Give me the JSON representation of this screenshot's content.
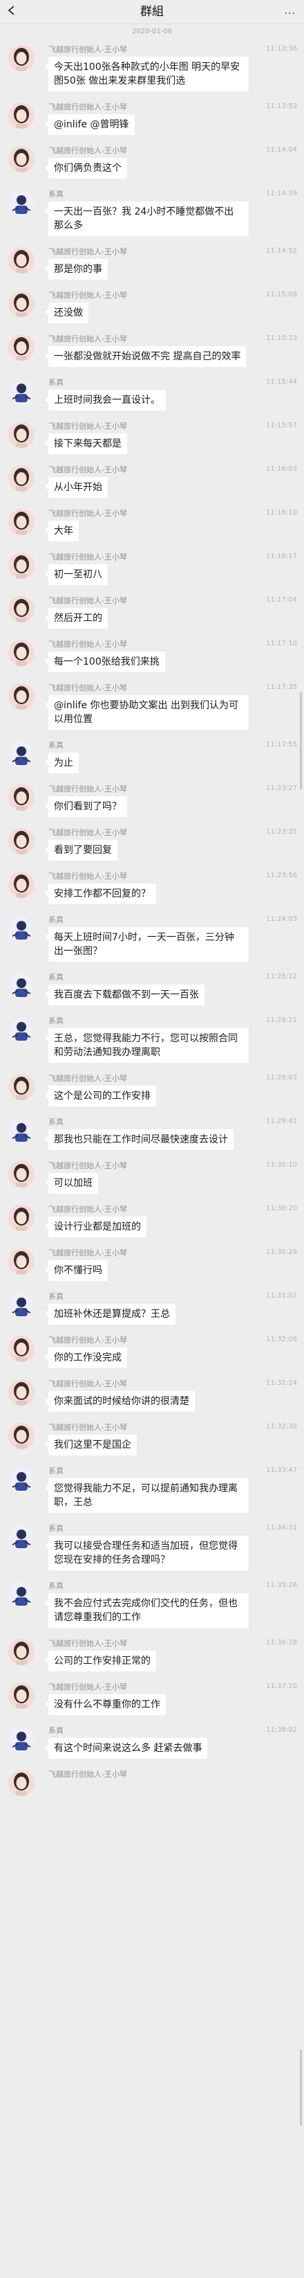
{
  "header": {
    "title": "群組",
    "more": "···"
  },
  "date_separator": "2020-01-06",
  "messages": [
    {
      "sender": "wang",
      "name": "飞越旅行创始人-王小琴",
      "time": "11:13:36",
      "text": "今天出100张各种款式的小年图 明天的早安图50张 做出来发来群里我们选"
    },
    {
      "sender": "wang",
      "name": "飞越旅行创始人-王小琴",
      "time": "11:13:53",
      "text": "@inlife @曾明锋"
    },
    {
      "sender": "wang",
      "name": "飞越旅行创始人-王小琴",
      "time": "11:14:04",
      "text": "你们俩负责这个"
    },
    {
      "sender": "xi",
      "name": "系真",
      "time": "11:14:39",
      "text": "一天出一百张？我 24小时不睡觉都做不出那么多"
    },
    {
      "sender": "wang",
      "name": "飞越旅行创始人-王小琴",
      "time": "11:14:52",
      "text": "那是你的事"
    },
    {
      "sender": "wang",
      "name": "飞越旅行创始人-王小琴",
      "time": "11:15:09",
      "text": "还没做"
    },
    {
      "sender": "wang",
      "name": "飞越旅行创始人-王小琴",
      "time": "11:15:33",
      "text": "一张都没做就开始说做不完 提高自己的效率"
    },
    {
      "sender": "xi",
      "name": "系真",
      "time": "11:15:44",
      "text": "上班时间我会一直设计。"
    },
    {
      "sender": "wang",
      "name": "飞越旅行创始人-王小琴",
      "time": "11:15:57",
      "text": "接下来每天都是"
    },
    {
      "sender": "wang",
      "name": "飞越旅行创始人-王小琴",
      "time": "11:16:03",
      "text": "从小年开始"
    },
    {
      "sender": "wang",
      "name": "飞越旅行创始人-王小琴",
      "time": "11:16:10",
      "text": "大年"
    },
    {
      "sender": "wang",
      "name": "飞越旅行创始人-王小琴",
      "time": "11:16:17",
      "text": "初一至初八"
    },
    {
      "sender": "wang",
      "name": "飞越旅行创始人-王小琴",
      "time": "11:17:04",
      "text": "然后开工的"
    },
    {
      "sender": "wang",
      "name": "飞越旅行创始人-王小琴",
      "time": "11:17:10",
      "text": "每一个100张给我们来挑"
    },
    {
      "sender": "wang",
      "name": "飞越旅行创始人-王小琴",
      "time": "11:17:35",
      "text": "@inlife 你也要协助文案出 出到我们认为可以用位置"
    },
    {
      "sender": "xi",
      "name": "系真",
      "time": "11:17:55",
      "text": "为止"
    },
    {
      "sender": "wang",
      "name": "飞越旅行创始人-王小琴",
      "time": "11:23:27",
      "text": "你们看到了吗？"
    },
    {
      "sender": "wang",
      "name": "飞越旅行创始人-王小琴",
      "time": "11:23:35",
      "text": "看到了要回复"
    },
    {
      "sender": "wang",
      "name": "飞越旅行创始人-王小琴",
      "time": "11:23:56",
      "text": "安排工作都不回复的？"
    },
    {
      "sender": "xi",
      "name": "系真",
      "time": "11:24:03",
      "text": "每天上班时间7小时，一天一百张，三分钟出一张图？"
    },
    {
      "sender": "xi",
      "name": "系真",
      "time": "11:25:12",
      "text": "我百度去下载都做不到一天一百张"
    },
    {
      "sender": "xi",
      "name": "系真",
      "time": "11:28:21",
      "text": "王总，您觉得我能力不行，您可以按照合同和劳动法通知我办理离职"
    },
    {
      "sender": "wang",
      "name": "飞越旅行创始人-王小琴",
      "time": "11:29:03",
      "text": "这个是公司的工作安排"
    },
    {
      "sender": "xi",
      "name": "系真",
      "time": "11:29:41",
      "text": "那我也只能在工作时间尽最快速度去设计"
    },
    {
      "sender": "wang",
      "name": "飞越旅行创始人-王小琴",
      "time": "11:30:10",
      "text": "可以加班"
    },
    {
      "sender": "wang",
      "name": "飞越旅行创始人-王小琴",
      "time": "11:30:20",
      "text": "设计行业都是加班的"
    },
    {
      "sender": "wang",
      "name": "飞越旅行创始人-王小琴",
      "time": "11:30:29",
      "text": "你不懂行吗"
    },
    {
      "sender": "xi",
      "name": "系真",
      "time": "11:31:02",
      "text": "加班补休还是算提成？王总"
    },
    {
      "sender": "wang",
      "name": "飞越旅行创始人-王小琴",
      "time": "11:32:08",
      "text": "你的工作没完成"
    },
    {
      "sender": "wang",
      "name": "飞越旅行创始人-王小琴",
      "time": "11:32:24",
      "text": "你来面试的时候给你讲的很清楚"
    },
    {
      "sender": "wang",
      "name": "飞越旅行创始人-王小琴",
      "time": "11:32:36",
      "text": "我们这里不是国企"
    },
    {
      "sender": "xi",
      "name": "系真",
      "time": "11:33:47",
      "text": "您觉得我能力不足，可以提前通知我办理离职，王总"
    },
    {
      "sender": "xi",
      "name": "系真",
      "time": "11:34:31",
      "text": "我可以接受合理任务和适当加班，但您觉得您现在安排的任务合理吗？"
    },
    {
      "sender": "xi",
      "name": "系真",
      "time": "11:35:26",
      "text": "我不会应付式去完成你们交代的任务，但也请您尊重我们的工作"
    },
    {
      "sender": "wang",
      "name": "飞越旅行创始人-王小琴",
      "time": "11:36:28",
      "text": "公司的工作安排正常的"
    },
    {
      "sender": "wang",
      "name": "飞越旅行创始人-王小琴",
      "time": "11:37:20",
      "text": "没有什么不尊重你的工作"
    },
    {
      "sender": "xi",
      "name": "系真",
      "time": "11:38:02",
      "text": "有这个时间来说这么多 赶紧去做事"
    },
    {
      "sender": "wang",
      "name": "飞越旅行创始人-王小琴",
      "time": "",
      "text": ""
    }
  ]
}
